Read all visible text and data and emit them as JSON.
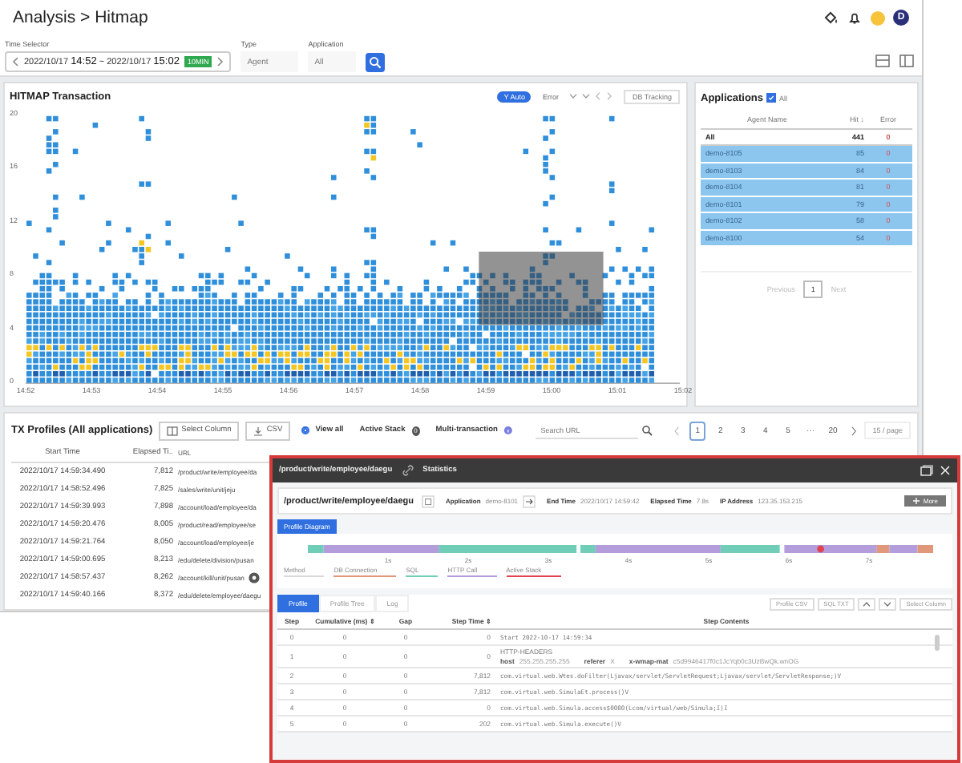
{
  "header": {
    "breadcrumb": "Analysis > Hitmap",
    "avatar": "D"
  },
  "filters": {
    "time": {
      "label": "Time Selector",
      "start_date": "2022/10/17",
      "start_time": "14:52",
      "separator": "~",
      "end_date": "2022/10/17",
      "end_time": "15:02",
      "badge": "10MIN"
    },
    "type": {
      "label": "Type",
      "value": "Agent"
    },
    "application": {
      "label": "Application",
      "value": "All"
    }
  },
  "hitmap": {
    "title": "HITMAP Transaction",
    "options": [
      {
        "label": "Y Auto",
        "selected": true
      },
      {
        "label": "Error",
        "selected": false
      }
    ],
    "db_tracking": "DB Tracking",
    "y_ticks": [
      "20",
      "16",
      "12",
      "8",
      "4",
      "0"
    ],
    "x_ticks": [
      "14:52",
      "14:53",
      "14:54",
      "14:55",
      "14:56",
      "14:57",
      "14:58",
      "14:59",
      "15:00",
      "15:01",
      "15:02"
    ]
  },
  "applications": {
    "title": "Applications",
    "all_checked": true,
    "all_label": "All",
    "columns": [
      "Agent Name",
      "Hit ↓",
      "Error"
    ],
    "rows": [
      {
        "name": "All",
        "hit": "441",
        "error": "0",
        "selected": false
      },
      {
        "name": "demo-8105",
        "hit": "85",
        "error": "0",
        "selected": true
      },
      {
        "name": "demo-8103",
        "hit": "84",
        "error": "0",
        "selected": true
      },
      {
        "name": "demo-8104",
        "hit": "81",
        "error": "0",
        "selected": true
      },
      {
        "name": "demo-8101",
        "hit": "79",
        "error": "0",
        "selected": true
      },
      {
        "name": "demo-8102",
        "hit": "58",
        "error": "0",
        "selected": true
      },
      {
        "name": "demo-8100",
        "hit": "54",
        "error": "0",
        "selected": true
      }
    ],
    "pagination": {
      "previous": "Previous",
      "page": "1",
      "next": "Next"
    }
  },
  "tx_profiles": {
    "title": "TX Profiles (All applications)",
    "select_column": "Select Column",
    "csv": "CSV",
    "view_all": {
      "label": "View all",
      "selected": true
    },
    "active_stack": {
      "label": "Active Stack",
      "count": "0"
    },
    "multi_transaction": "Multi-transaction",
    "search_placeholder": "Search URL",
    "pages": [
      {
        "label": "1",
        "selected": true
      },
      {
        "label": "2",
        "selected": false
      },
      {
        "label": "3",
        "selected": false
      },
      {
        "label": "4",
        "selected": false
      },
      {
        "label": "5",
        "selected": false
      },
      {
        "label": "···",
        "selected": false
      },
      {
        "label": "20",
        "selected": false
      }
    ],
    "page_size": "15 / page",
    "columns": [
      "Start Time",
      "Elapsed Ti..",
      "URL"
    ],
    "rows": [
      {
        "start": "2022/10/17 14:59:34.490",
        "elapsed": "7,812",
        "url": "/product/write/employee/da",
        "marked": false
      },
      {
        "start": "2022/10/17 14:58:52.496",
        "elapsed": "7,825",
        "url": "/sales/write/unit/jeju",
        "marked": false
      },
      {
        "start": "2022/10/17 14:59:39.993",
        "elapsed": "7,898",
        "url": "/account/load/employee/da",
        "marked": false
      },
      {
        "start": "2022/10/17 14:59:20.476",
        "elapsed": "8,005",
        "url": "/product/read/employee/se",
        "marked": false
      },
      {
        "start": "2022/10/17 14:59:21.764",
        "elapsed": "8,050",
        "url": "/account/load/employee/je",
        "marked": false
      },
      {
        "start": "2022/10/17 14:59:00.695",
        "elapsed": "8,213",
        "url": "/edu/delete/division/pusan",
        "marked": false
      },
      {
        "start": "2022/10/17 14:58:57.437",
        "elapsed": "8,262",
        "url": "/account/kill/unit/pusan",
        "marked": true
      },
      {
        "start": "2022/10/17 14:59:40.166",
        "elapsed": "8,372",
        "url": "/edu/delete/employee/daegu",
        "marked": false
      }
    ]
  },
  "popup": {
    "title": "/product/write/employee/daegu",
    "statistics": "Statistics",
    "url": "/product/write/employee/daegu",
    "fields": [
      {
        "label": "Application",
        "value": "demo-8101",
        "link": true
      },
      {
        "label": "End Time",
        "value": "2022/10/17 14:59:42",
        "link": false
      },
      {
        "label": "Elapsed Time",
        "value": "7.8s",
        "link": false
      },
      {
        "label": "IP Address",
        "value": "123.35.153.215",
        "link": false
      }
    ],
    "more": "More",
    "diagram_tab": "Profile Diagram",
    "timeline_ticks": [
      "1s",
      "2s",
      "3s",
      "4s",
      "5s",
      "6s",
      "7s"
    ],
    "legend": [
      {
        "label": "Method",
        "color": "#d9d9d9"
      },
      {
        "label": "DB Connection",
        "color": "#e0977a"
      },
      {
        "label": "SQL",
        "color": "#6fcdb8"
      },
      {
        "label": "HTTP Call",
        "color": "#b39ddb"
      },
      {
        "label": "Active Stack",
        "color": "#e0434f"
      }
    ],
    "tabs": [
      {
        "label": "Profile",
        "selected": true
      },
      {
        "label": "Profile Tree",
        "selected": false
      },
      {
        "label": "Log",
        "selected": false
      }
    ],
    "actions": [
      {
        "kind": "text",
        "label": "Profile CSV"
      },
      {
        "kind": "text",
        "label": "SQL TXT"
      },
      {
        "kind": "up"
      },
      {
        "kind": "down"
      },
      {
        "kind": "text",
        "label": "Select Column"
      }
    ],
    "columns": [
      "Step",
      "Cumulative (ms) ⇕",
      "Gap",
      "Step Time ⇕",
      "Step Contents"
    ],
    "rows": [
      {
        "step": "0",
        "cumulative": "0",
        "gap": "0",
        "step_time": "0",
        "content": "Start 2022-10-17 14:59:34"
      },
      {
        "step": "1",
        "cumulative": "0",
        "gap": "0",
        "step_time": "0",
        "content": "HTTP-HEADERS",
        "details": [
          {
            "key": "host",
            "value": "255.255.255.255"
          },
          {
            "key": "referer",
            "value": "X"
          },
          {
            "key": "x-wmap-mat",
            "value": "c5d9946417f0c1JcYqb0c3UzBwQk.wnOG"
          }
        ]
      },
      {
        "step": "2",
        "cumulative": "0",
        "gap": "0",
        "step_time": "7,812",
        "content": "com.virtual.web.Wtes.doFilter(Ljavax/servlet/ServletRequest;Ljavax/servlet/ServletResponse;)V"
      },
      {
        "step": "3",
        "cumulative": "0",
        "gap": "0",
        "step_time": "7,812",
        "content": "com.virtual.web.SimulaEt.process()V"
      },
      {
        "step": "4",
        "cumulative": "0",
        "gap": "0",
        "step_time": "0",
        "content": "com.virtual.web.Simula.access$0000(Lcom/virtual/web/Simula;I)I"
      },
      {
        "step": "5",
        "cumulative": "0",
        "gap": "0",
        "step_time": "202",
        "content": "com.virtual.web.Simula.execute()V"
      }
    ]
  }
}
